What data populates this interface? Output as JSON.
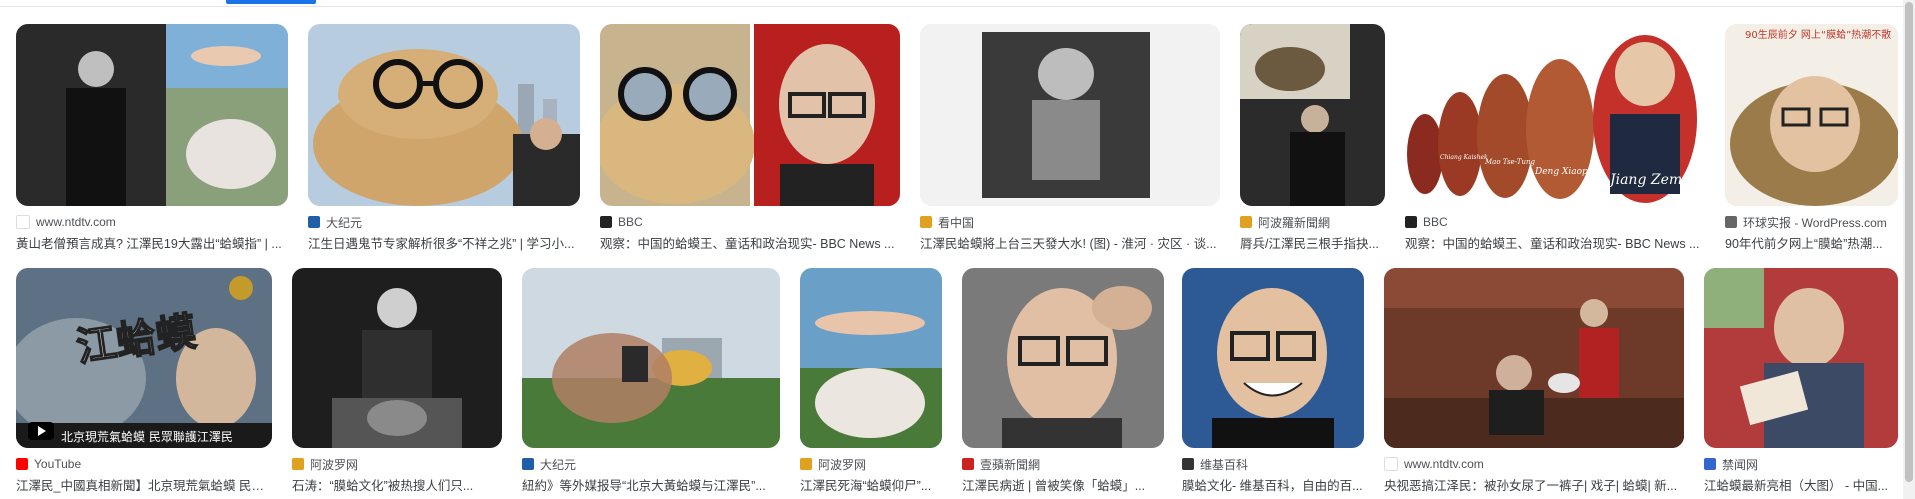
{
  "results_row1": [
    {
      "source": "www.ntdtv.com",
      "title": "黃山老僧預言成真? 江澤民19大露出“蛤蟆指” | ...",
      "favicon_color": "#ffffff"
    },
    {
      "source": "大纪元",
      "title": "江生日遇鬼节专家解析很多“不祥之兆” | 学习小...",
      "favicon_color": "#1f5fa8"
    },
    {
      "source": "BBC",
      "title": "观察：中国的蛤蟆王、童话和政治现实- BBC News ...",
      "favicon_color": "#222222"
    },
    {
      "source": "看中国",
      "title": "江澤民蛤蟆將上台三天發大水! (图) - 淮河 · 灾区 · 谈...",
      "favicon_color": "#e0a020"
    },
    {
      "source": "阿波羅新聞網",
      "title": "脣兵/江澤民三根手指抉...",
      "favicon_color": "#e0a020"
    },
    {
      "source": "BBC",
      "title": "观察：中国的蛤蟆王、童话和政治现实- BBC News ...",
      "favicon_color": "#222222"
    },
    {
      "source": "环球实报 - WordPress.com",
      "title": "90年代前夕网上“膜蛤”热潮...",
      "favicon_color": "#666666"
    }
  ],
  "results_row2": [
    {
      "source": "YouTube",
      "title": "江澤民_中國真相新聞】北京現荒氣蛤蟆 民眾...",
      "favicon_color": "#ff0000"
    },
    {
      "source": "阿波罗网",
      "title": "石涛：“膜蛤文化”被热搜人们只...",
      "favicon_color": "#e0a020"
    },
    {
      "source": "大纪元",
      "title": "紐約》等外媒报导“北京大黃蛤蟆与江澤民”...",
      "favicon_color": "#1f5fa8"
    },
    {
      "source": "阿波罗网",
      "title": "江澤民死海“蛤蟆仰尸”...",
      "favicon_color": "#e0a020"
    },
    {
      "source": "壹蘋新聞網",
      "title": "江澤民病逝 | 曾被笑像「蛤蟆」...",
      "favicon_color": "#cc2222"
    },
    {
      "source": "维基百科",
      "title": "膜蛤文化- 维基百科，自由的百...",
      "favicon_color": "#333333"
    },
    {
      "source": "www.ntdtv.com",
      "title": "央视恶搞江泽民：被孙女尿了一裤子| 戏子| 蛤蟆| 新...",
      "favicon_color": "#ffffff"
    },
    {
      "source": "禁闻网",
      "title": "江蛤蟆最新亮相（大图） - 中国...",
      "favicon_color": "#3366cc"
    }
  ],
  "overlays": {
    "banner_big": "江蛤蟆",
    "banner_sub": "北京現荒氣蛤蟆 民眾聯護江澤民",
    "doll_sig_1": "Jiang Zemin",
    "doll_sig_2": "Deng Xiaoping",
    "doll_sig_3": "Mao Tse-Tung",
    "doll_sig_4": "Chiang Kaishek",
    "frog_caption": "90生辰前夕 网上“膜蛤”热潮不散"
  }
}
